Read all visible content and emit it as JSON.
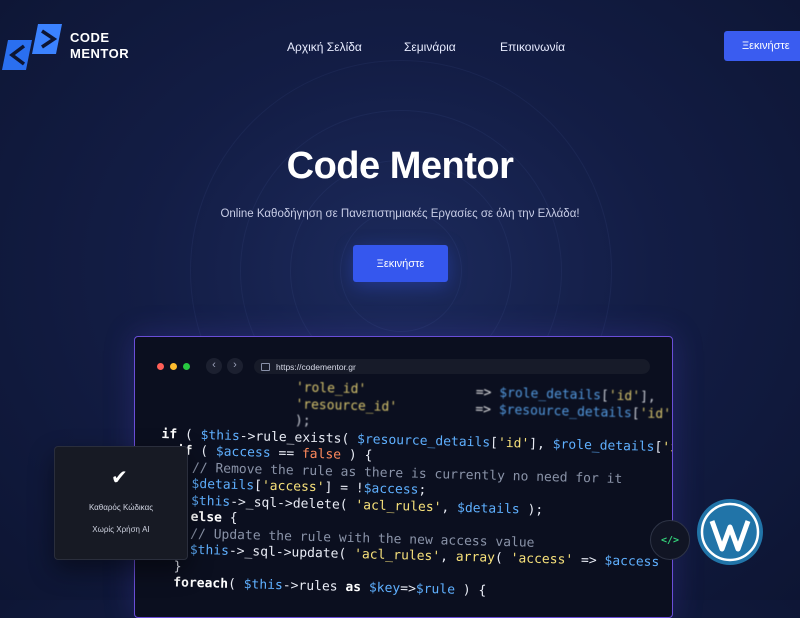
{
  "brand": {
    "line1": "CODE",
    "line2": "MENTOR"
  },
  "nav": {
    "items": [
      "Αρχική Σελίδα",
      "Σεμινάρια",
      "Επικοινωνία"
    ],
    "cta_label": "Ξεκινήστε"
  },
  "hero": {
    "title": "Code Mentor",
    "subtitle": "Online Καθοδήγηση σε Πανεπιστημιακές Εργασίες σε όλη την Ελλάδα!",
    "cta_label": "Ξεκινήστε"
  },
  "browser": {
    "url": "https://codementor.gr"
  },
  "card": {
    "line1": "Καθαρός Κώδικας",
    "line2": "Χωρίς Χρήση AI"
  },
  "badges": {
    "code_symbol": "</>",
    "wordpress": "wordpress-logo"
  },
  "colors": {
    "accent": "#3557ee",
    "border_purple": "#6a4ed8",
    "code_green": "#34d17a",
    "wp_blue": "#2174a8"
  }
}
